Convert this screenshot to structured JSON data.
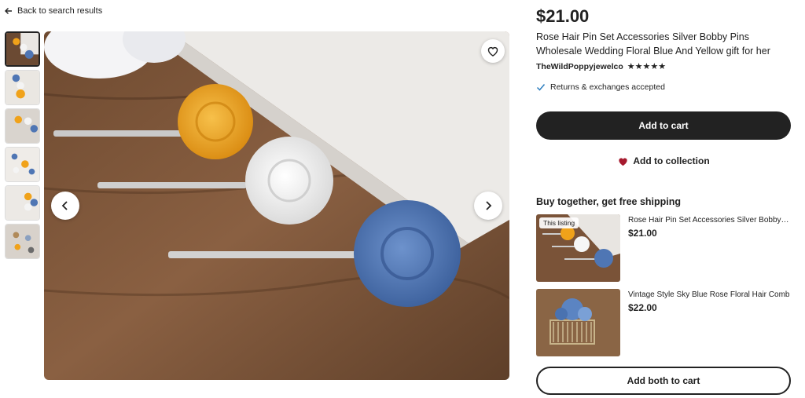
{
  "nav": {
    "back_label": "Back to search results"
  },
  "listing": {
    "price": "$21.00",
    "title": "Rose Hair Pin Set Accessories Silver Bobby Pins Wholesale Wedding Floral Blue And Yellow gift for her",
    "shop_name": "TheWildPoppyjewelco",
    "rating_stars": "★★★★★",
    "rating_value": 5,
    "returns_text": "Returns & exchanges accepted",
    "add_to_cart_label": "Add to cart",
    "add_to_collection_label": "Add to collection"
  },
  "gallery": {
    "thumbnail_count": 6,
    "selected_index": 0,
    "icons": {
      "favorite": "heart-outline-icon",
      "prev": "chevron-left-icon",
      "next": "chevron-right-icon"
    }
  },
  "bundle": {
    "heading": "Buy together, get free shipping",
    "items": [
      {
        "badge": "This listing",
        "title": "Rose Hair Pin Set Accessories Silver Bobby Pins Wholesale Wedding Floral Blue And Yellow gift for her",
        "price": "$21.00"
      },
      {
        "title": "Vintage Style Sky Blue Rose Floral Hair Comb",
        "price": "$22.00"
      }
    ],
    "add_both_label": "Add both to cart"
  },
  "colors": {
    "primary_button": "#222222",
    "favorite_heart": "#a61a2e",
    "check": "#2f7fbf"
  }
}
